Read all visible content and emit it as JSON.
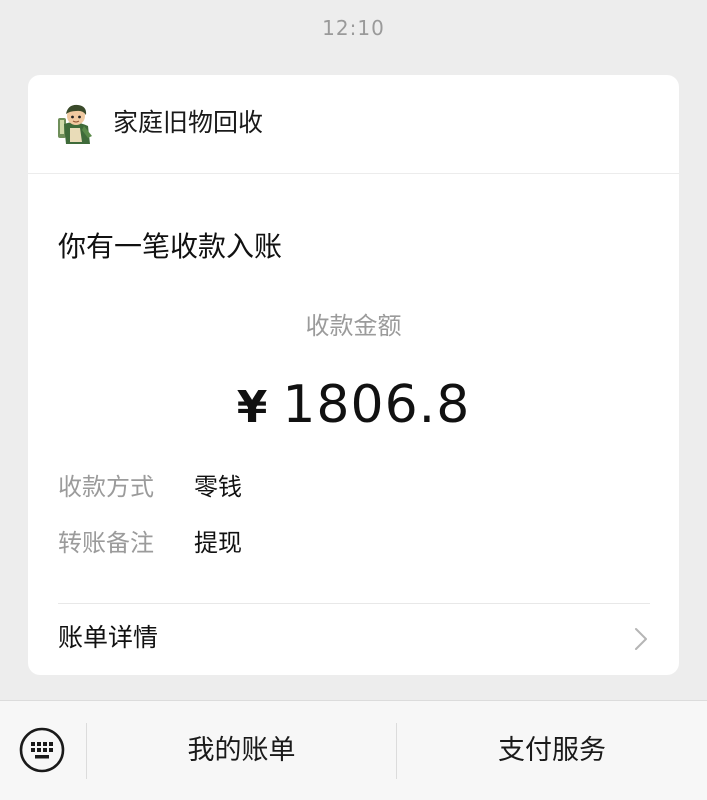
{
  "status": {
    "time": "12:10"
  },
  "card": {
    "merchant_name": "家庭旧物回收",
    "avatar_icon": "cartoon-character-avatar",
    "notice_title": "你有一笔收款入账",
    "amount_label": "收款金额",
    "currency_symbol": "¥",
    "amount": "1806.8",
    "details": [
      {
        "label": "收款方式",
        "value": "零钱"
      },
      {
        "label": "转账备注",
        "value": "提现"
      }
    ],
    "bill_detail_label": "账单详情",
    "bill_detail_icon": "chevron-right-icon"
  },
  "bottom_bar": {
    "keyboard_icon": "keyboard-icon",
    "menu": [
      {
        "label": "我的账单"
      },
      {
        "label": "支付服务"
      }
    ]
  },
  "colors": {
    "background": "#ededed",
    "card": "#ffffff",
    "secondary_text": "#9b9b9b",
    "primary_text": "#111111"
  }
}
